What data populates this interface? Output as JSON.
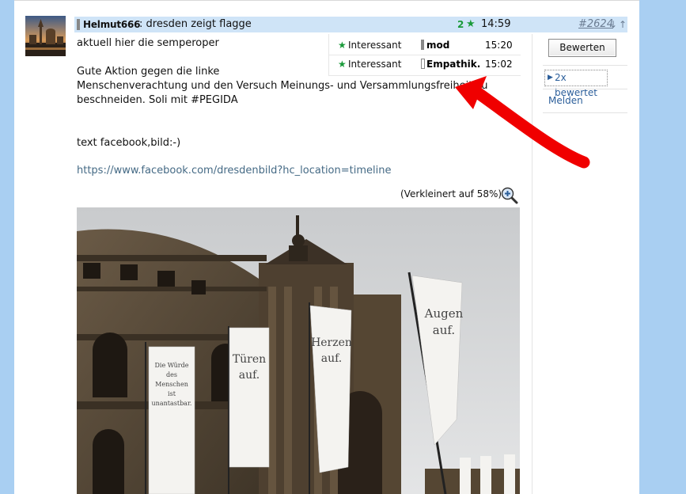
{
  "post": {
    "author": "Helmut666",
    "title": ": dresden zeigt flagge",
    "rating_count": "2",
    "time": "14:59",
    "post_number": "#2624",
    "nav_down": "↓",
    "nav_up": "↑"
  },
  "body": {
    "line1": "aktuell hier die semperoper",
    "line2": "Gute Aktion gegen die linke",
    "line3": "Menschenverachtung und den Versuch Meinungs- und Versammlungsfreiheit zu",
    "line4": "beschneiden. Soli mit #PEGIDA",
    "line5": "text facebook,bild:-)",
    "link": "https://www.facebook.com/dresdenbild?hc_location=timeline",
    "shrink_note": "(Verkleinert auf 58%)"
  },
  "ratings": [
    {
      "label": "Interessant",
      "user": "mod",
      "time": "15:20"
    },
    {
      "label": "Interessant",
      "user": "Empathik.",
      "time": "15:02"
    }
  ],
  "sidebar": {
    "rate_button": "Bewerten",
    "rated_toggle": "2x bewertet",
    "report_link": "Melden"
  },
  "banners": {
    "b1": [
      "Die Würde",
      "des",
      "Menschen",
      "ist",
      "unantastbar."
    ],
    "b2": [
      "Türen",
      "auf."
    ],
    "b3": [
      "Herzen",
      "auf."
    ],
    "b4": [
      "Augen",
      "auf."
    ]
  },
  "colors": {
    "accent_green": "#1a9a3a",
    "link_blue": "#2b5e9a",
    "header_bg": "#cfe4f7",
    "page_bg": "#a9cff2",
    "arrow_red": "#f00000"
  }
}
